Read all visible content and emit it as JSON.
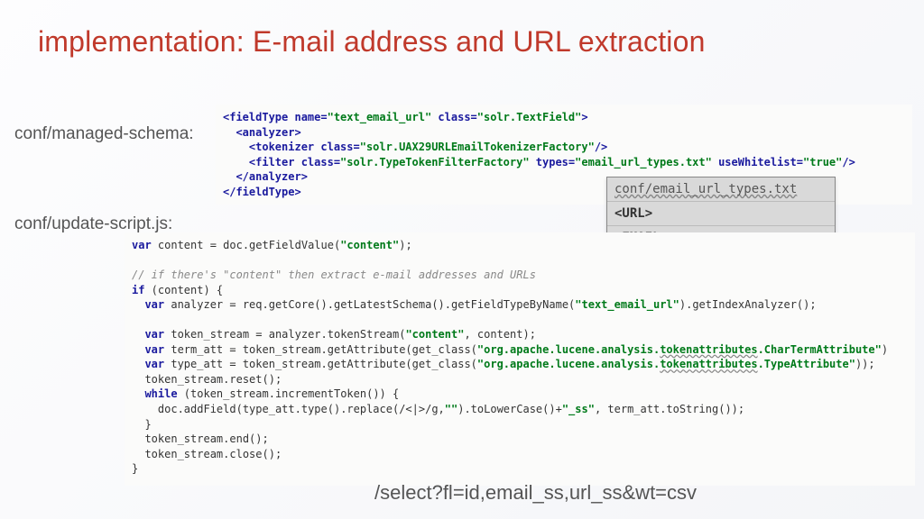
{
  "title": "implementation: E-mail address and URL extraction",
  "labels": {
    "schema": "conf/managed-schema:",
    "script": "conf/update-script.js:"
  },
  "schema_code": {
    "fieldType_open": "<fieldType",
    "name_attr": " name=",
    "name_val": "\"text_email_url\"",
    "class_attr": " class=",
    "class_val": "\"solr.TextField\"",
    "close": ">",
    "analyzer_open": "  <analyzer>",
    "tokenizer": "    <tokenizer class=",
    "tokenizer_val": "\"solr.UAX29URLEmailTokenizerFactory\"",
    "selfclose": "/>",
    "filter": "    <filter class=",
    "filter_val": "\"solr.TypeTokenFilterFactory\"",
    "types_attr": " types=",
    "types_val": "\"email_url_types.txt\"",
    "usewl_attr": " useWhitelist=",
    "usewl_val": "\"true\"",
    "analyzer_close": "  </analyzer>",
    "fieldType_close": "</fieldType>"
  },
  "types_file": {
    "filename": "conf/email_url_types.txt",
    "line1": "<URL>",
    "line2": "<EMAIL>"
  },
  "script_code": {
    "l1_a": "var",
    "l1_b": " content = doc.getFieldValue(",
    "l1_c": "\"content\"",
    "l1_d": ");",
    "l2": "// if there's \"content\" then extract e-mail addresses and URLs",
    "l3_a": "if",
    "l3_b": " (content) {",
    "l4_a": "  var",
    "l4_b": " analyzer = req.getCore().getLatestSchema().getFieldTypeByName(",
    "l4_c": "\"text_email_url\"",
    "l4_d": ").getIndexAnalyzer();",
    "l5_a": "  var",
    "l5_b": " token_stream = analyzer.tokenStream(",
    "l5_c": "\"content\"",
    "l5_d": ", content);",
    "l6_a": "  var",
    "l6_b": " term_att = token_stream.getAttribute(get_class(",
    "l6_c": "\"org.apache.lucene.analysis.",
    "l6_w": "tokenattributes",
    "l6_e": ".CharTermAttribute\"",
    "l6_f": ")",
    "l7_a": "  var",
    "l7_b": " type_att = token_stream.getAttribute(get_class(",
    "l7_c": "\"org.apache.lucene.analysis.",
    "l7_e": ".TypeAttribute\"",
    "l7_f": "));",
    "l8": "  token_stream.reset();",
    "l9_a": "  while",
    "l9_b": " (token_stream.incrementToken()) {",
    "l10_a": "    doc.addField(type_att.type().replace(/<|>/g,",
    "l10_b": "\"\"",
    "l10_c": ").toLowerCase()+",
    "l10_d": "\"_ss\"",
    "l10_e": ", term_att.toString());",
    "l11": "  }",
    "l12": "  token_stream.end();",
    "l13": "  token_stream.close();",
    "l14": "}"
  },
  "query": "/select?fl=id,email_ss,url_ss&wt=csv"
}
